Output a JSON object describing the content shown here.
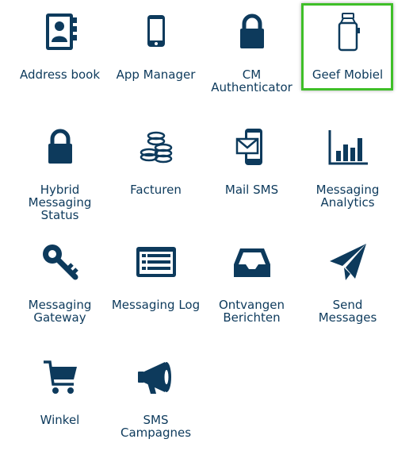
{
  "colors": {
    "icon": "#0d3a5c",
    "highlight": "#3fbf28"
  },
  "apps": [
    {
      "label": "Address book",
      "icon": "address-book-icon",
      "selected": false
    },
    {
      "label": "App Manager",
      "icon": "smartphone-icon",
      "selected": false
    },
    {
      "label": "CM\nAuthenticator",
      "icon": "lock-icon",
      "selected": false
    },
    {
      "label": "Geef Mobiel",
      "icon": "milk-can-icon",
      "selected": true
    },
    {
      "label": "Hybrid\nMessaging\nStatus",
      "icon": "lock-icon",
      "selected": false
    },
    {
      "label": "Facturen",
      "icon": "coins-icon",
      "selected": false
    },
    {
      "label": "Mail SMS",
      "icon": "phone-envelope-icon",
      "selected": false
    },
    {
      "label": "Messaging\nAnalytics",
      "icon": "bar-chart-icon",
      "selected": false
    },
    {
      "label": "Messaging\nGateway",
      "icon": "key-icon",
      "selected": false
    },
    {
      "label": "Messaging Log",
      "icon": "list-icon",
      "selected": false
    },
    {
      "label": "Ontvangen\nBerichten",
      "icon": "inbox-icon",
      "selected": false
    },
    {
      "label": "Send\nMessages",
      "icon": "paper-plane-icon",
      "selected": false
    },
    {
      "label": "Winkel",
      "icon": "shopping-cart-icon",
      "selected": false
    },
    {
      "label": "SMS\nCampagnes",
      "icon": "megaphone-icon",
      "selected": false
    }
  ]
}
